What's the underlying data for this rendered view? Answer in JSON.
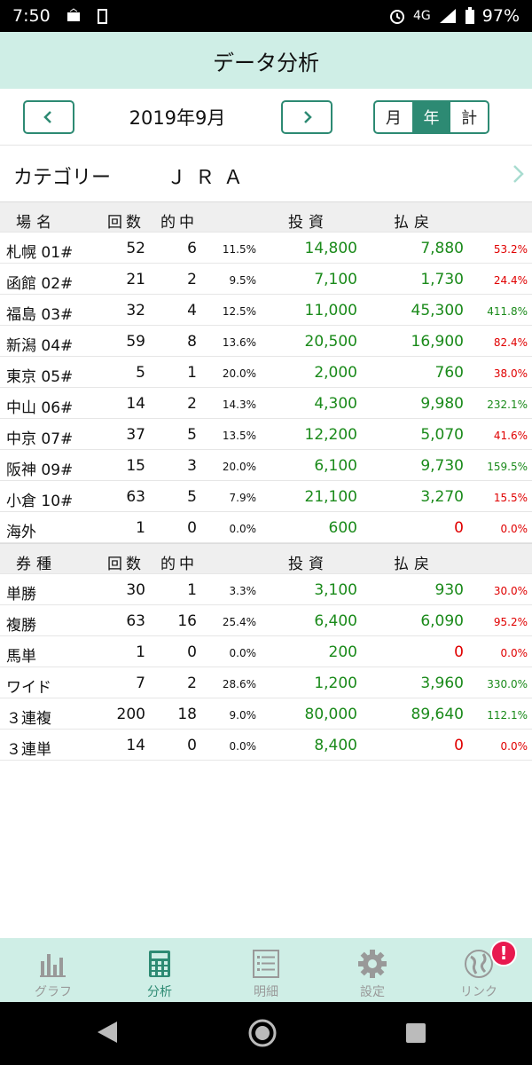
{
  "status": {
    "time": "7:50",
    "network": "4G",
    "battery": "97%"
  },
  "header": {
    "title": "データ分析"
  },
  "nav": {
    "month": "2019年9月",
    "seg": [
      "月",
      "年",
      "計"
    ]
  },
  "category": {
    "label": "カテゴリー",
    "value": "ＪＲＡ"
  },
  "venue_table": {
    "headers": {
      "name": "場名",
      "count": "回数",
      "hit": "的中",
      "investment": "投資",
      "return": "払戻"
    },
    "rows": [
      {
        "name": "札幌 01#",
        "count": "52",
        "hit": "6",
        "rate": "11.5%",
        "investment": "14,800",
        "return": "7,880",
        "pct": "53.2%"
      },
      {
        "name": "函館 02#",
        "count": "21",
        "hit": "2",
        "rate": "9.5%",
        "investment": "7,100",
        "return": "1,730",
        "pct": "24.4%"
      },
      {
        "name": "福島 03#",
        "count": "32",
        "hit": "4",
        "rate": "12.5%",
        "investment": "11,000",
        "return": "45,300",
        "pct": "411.8%"
      },
      {
        "name": "新潟 04#",
        "count": "59",
        "hit": "8",
        "rate": "13.6%",
        "investment": "20,500",
        "return": "16,900",
        "pct": "82.4%"
      },
      {
        "name": "東京 05#",
        "count": "5",
        "hit": "1",
        "rate": "20.0%",
        "investment": "2,000",
        "return": "760",
        "pct": "38.0%"
      },
      {
        "name": "中山 06#",
        "count": "14",
        "hit": "2",
        "rate": "14.3%",
        "investment": "4,300",
        "return": "9,980",
        "pct": "232.1%"
      },
      {
        "name": "中京 07#",
        "count": "37",
        "hit": "5",
        "rate": "13.5%",
        "investment": "12,200",
        "return": "5,070",
        "pct": "41.6%"
      },
      {
        "name": "阪神 09#",
        "count": "15",
        "hit": "3",
        "rate": "20.0%",
        "investment": "6,100",
        "return": "9,730",
        "pct": "159.5%"
      },
      {
        "name": "小倉 10#",
        "count": "63",
        "hit": "5",
        "rate": "7.9%",
        "investment": "21,100",
        "return": "3,270",
        "pct": "15.5%"
      },
      {
        "name": "海外",
        "count": "1",
        "hit": "0",
        "rate": "0.0%",
        "investment": "600",
        "return": "0",
        "pct": "0.0%"
      }
    ]
  },
  "ticket_table": {
    "headers": {
      "name": "券種",
      "count": "回数",
      "hit": "的中",
      "investment": "投資",
      "return": "払戻"
    },
    "rows": [
      {
        "name": "単勝",
        "count": "30",
        "hit": "1",
        "rate": "3.3%",
        "investment": "3,100",
        "return": "930",
        "pct": "30.0%"
      },
      {
        "name": "複勝",
        "count": "63",
        "hit": "16",
        "rate": "25.4%",
        "investment": "6,400",
        "return": "6,090",
        "pct": "95.2%"
      },
      {
        "name": "馬単",
        "count": "1",
        "hit": "0",
        "rate": "0.0%",
        "investment": "200",
        "return": "0",
        "pct": "0.0%"
      },
      {
        "name": "ワイド",
        "count": "7",
        "hit": "2",
        "rate": "28.6%",
        "investment": "1,200",
        "return": "3,960",
        "pct": "330.0%"
      },
      {
        "name": "３連複",
        "count": "200",
        "hit": "18",
        "rate": "9.0%",
        "investment": "80,000",
        "return": "89,640",
        "pct": "112.1%"
      },
      {
        "name": "３連単",
        "count": "14",
        "hit": "0",
        "rate": "0.0%",
        "investment": "8,400",
        "return": "0",
        "pct": "0.0%"
      }
    ]
  },
  "tabs": [
    {
      "label": "グラフ",
      "icon": "bar-chart-icon"
    },
    {
      "label": "分析",
      "icon": "calculator-icon"
    },
    {
      "label": "明細",
      "icon": "list-icon"
    },
    {
      "label": "設定",
      "icon": "gear-icon"
    },
    {
      "label": "リンク",
      "icon": "globe-icon"
    }
  ],
  "link_badge": "!",
  "colors": {
    "accent": "#2d8a73",
    "header_bg": "#cfeee6",
    "positive": "#1a8a1a",
    "negative": "#e00000"
  }
}
